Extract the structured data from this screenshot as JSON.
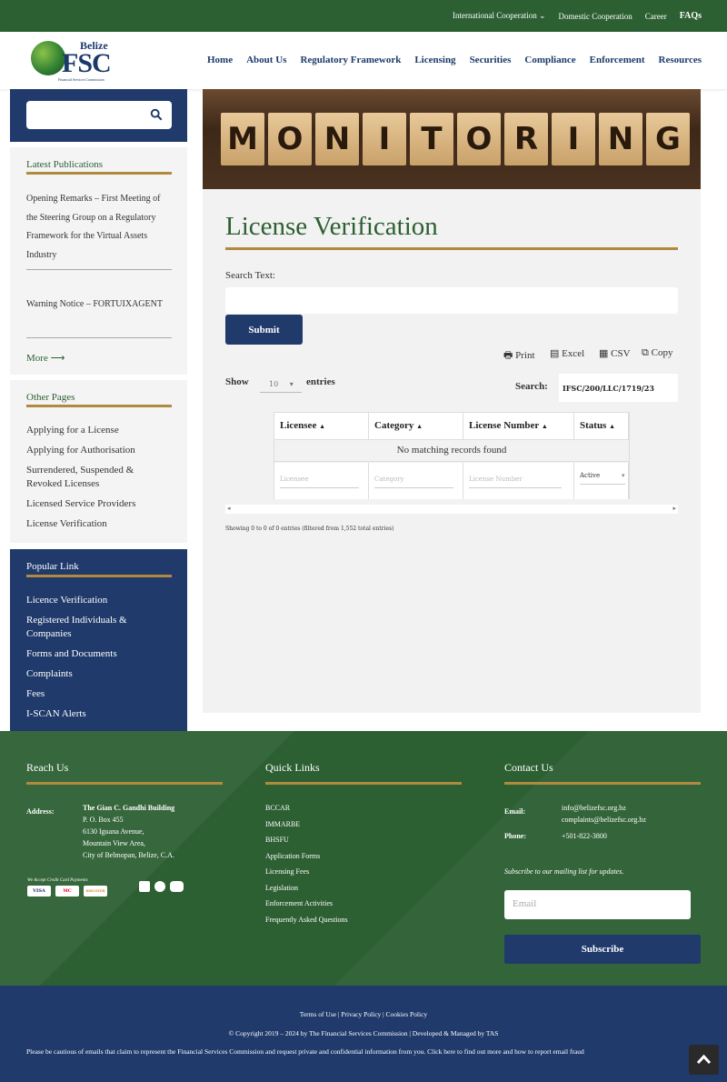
{
  "topbar": {
    "items": [
      "International Cooperation",
      "Domestic Cooperation",
      "Career",
      "FAQs"
    ]
  },
  "logo": {
    "belize": "Belize",
    "fsc": "FSC",
    "sub": "Financial Services Commission"
  },
  "nav": {
    "items": [
      "Home",
      "About Us",
      "Regulatory Framework",
      "Licensing",
      "Securities",
      "Compliance",
      "Enforcement",
      "Resources"
    ]
  },
  "sidebar": {
    "search_placeholder": "",
    "latest_title": "Latest Publications",
    "publications": [
      "Opening Remarks – First Meeting of the Steering Group on a Regulatory Framework for the Virtual Assets Industry",
      "Warning Notice – FORTUIXAGENT"
    ],
    "more": "More",
    "other_title": "Other Pages",
    "other_pages": [
      "Applying for a License",
      "Applying for Authorisation",
      "Surrendered, Suspended & Revoked Licenses",
      "Licensed Service Providers",
      "License Verification"
    ],
    "popular_title": "Popular Link",
    "popular_links": [
      "Licence Verification",
      "Registered Individuals & Companies",
      "Forms and Documents",
      "Complaints",
      "Fees",
      "I-SCAN Alerts"
    ]
  },
  "main": {
    "hero_letters": [
      "M",
      "O",
      "N",
      "I",
      "T",
      "O",
      "R",
      "I",
      "N",
      "G"
    ],
    "title": "License Verification",
    "search_label": "Search Text:",
    "search_value": "",
    "submit": "Submit",
    "export": {
      "print": "Print",
      "excel": "Excel",
      "csv": "CSV",
      "copy": "Copy"
    },
    "show": "Show",
    "entries_count": "10",
    "entries": "entries",
    "table_search_label": "Search:",
    "table_search_value": "IFSC/200/LLC/1719/23",
    "columns": [
      "Licensee",
      "Category",
      "License Number",
      "Status"
    ],
    "no_records": "No matching records found",
    "filters": {
      "licensee": "Licensee",
      "category": "Category",
      "license_number": "License Number",
      "status": "Active"
    },
    "showing": "Showing 0 to 0 of 0 entries (filtered from 1,552 total entries)"
  },
  "footer": {
    "reach_title": "Reach Us",
    "address_label": "Address:",
    "address_name": "The Gian C. Gandhi Building",
    "address_lines": [
      "P. O. Box 455",
      "6130 Iguana Avenue,",
      "Mountain View Area,",
      "City of Belmopan, Belize, C.A."
    ],
    "cards_label": "We Accept Credit Card Payments",
    "cards": [
      "VISA",
      "MC",
      "DISCOVER"
    ],
    "quick_title": "Quick Links",
    "quick_links": [
      "BCCAR",
      "IMMARBE",
      "BHSFU",
      "Application Forms",
      "Licensing Fees",
      "Legislation",
      "Enforcement Activities",
      "Frequently Asked Questions"
    ],
    "contact_title": "Contact Us",
    "email_label": "Email:",
    "emails": [
      "info@belizefsc.org.bz",
      "complaints@belizefsc.org.bz"
    ],
    "phone_label": "Phone:",
    "phone": "+501-822-3800",
    "subscribe_text": "Subscribe to our mailing list for updates.",
    "email_placeholder": "Email",
    "subscribe": "Subscribe"
  },
  "bottom": {
    "links": "Terms of Use | Privacy Policy | Cookies Policy",
    "copyright": "© Copyright 2019 – 2024 by The Financial Services Commission | Developed & Managed by TAS",
    "warning": "Please be cautious of emails that claim to represent the Financial Services Commission and request private and confidential information from you. Click here to find out more and how to report email fraud"
  }
}
